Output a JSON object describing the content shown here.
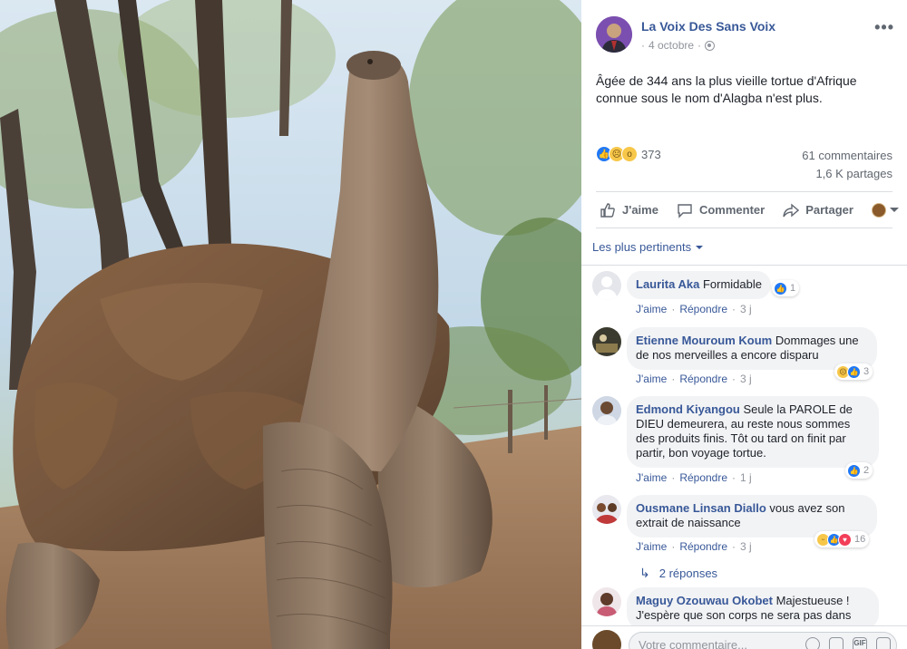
{
  "post": {
    "page_name": "La Voix Des Sans Voix",
    "date": "4 octobre",
    "text": "Âgée de 344 ans la plus vieille tortue d'Afrique connue sous le nom d'Alagba n'est plus.",
    "reaction_count": "373",
    "comments_count": "61 commentaires",
    "shares_count": "1,6 K partages"
  },
  "actions": {
    "like": "J'aime",
    "comment": "Commenter",
    "share": "Partager"
  },
  "sort_label": "Les plus pertinents",
  "comments": [
    {
      "name": "Laurita Aka",
      "text": "Formidable",
      "like": "J'aime",
      "reply": "Répondre",
      "time": "3 j",
      "reactions": "1"
    },
    {
      "name": "Etienne Mouroum Koum",
      "text": "Dommages une de nos merveilles a encore disparu",
      "like": "J'aime",
      "reply": "Répondre",
      "time": "3 j",
      "reactions": "3"
    },
    {
      "name": "Edmond Kiyangou",
      "text": "Seule la PAROLE de DIEU demeurera, au reste nous sommes des produits finis. Tôt ou tard on finit par partir, bon voyage tortue.",
      "like": "J'aime",
      "reply": "Répondre",
      "time": "1 j",
      "reactions": "2"
    },
    {
      "name": "Ousmane Linsan Diallo",
      "text": "vous avez son extrait de naissance",
      "like": "J'aime",
      "reply": "Répondre",
      "time": "3 j",
      "reactions": "16"
    },
    {
      "name": "Maguy Ozouwau Okobet",
      "text": "Majestueuse ! J'espère que son corps ne sera pas dans"
    }
  ],
  "replies_label": "2 réponses",
  "composer_placeholder": "Votre commentaire...",
  "colors": {
    "link": "#385898",
    "meta": "#90949c",
    "bubble": "#f2f3f5"
  }
}
